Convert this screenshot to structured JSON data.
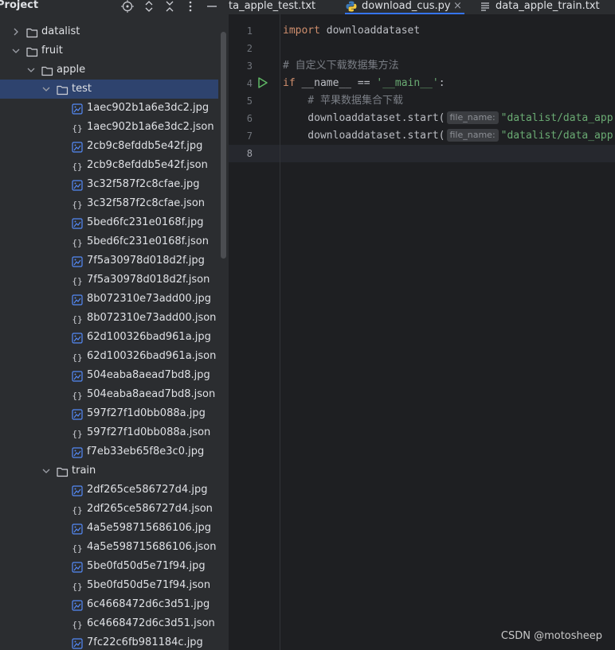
{
  "project": {
    "title": "Project",
    "header_icons": [
      "crosshair-icon",
      "expand-icon",
      "collapse-icon",
      "more-icon",
      "minimize-icon"
    ]
  },
  "tree": [
    {
      "label": "datalist",
      "type": "folder",
      "depth": 1,
      "expanded": false
    },
    {
      "label": "fruit",
      "type": "folder",
      "depth": 1,
      "expanded": true
    },
    {
      "label": "apple",
      "type": "folder",
      "depth": 2,
      "expanded": true
    },
    {
      "label": "test",
      "type": "folder",
      "depth": 3,
      "expanded": true,
      "selected": true
    },
    {
      "label": "1aec902b1a6e3dc2.jpg",
      "type": "image",
      "depth": 4
    },
    {
      "label": "1aec902b1a6e3dc2.json",
      "type": "json",
      "depth": 4
    },
    {
      "label": "2cb9c8efddb5e42f.jpg",
      "type": "image",
      "depth": 4
    },
    {
      "label": "2cb9c8efddb5e42f.json",
      "type": "json",
      "depth": 4
    },
    {
      "label": "3c32f587f2c8cfae.jpg",
      "type": "image",
      "depth": 4
    },
    {
      "label": "3c32f587f2c8cfae.json",
      "type": "json",
      "depth": 4
    },
    {
      "label": "5bed6fc231e0168f.jpg",
      "type": "image",
      "depth": 4
    },
    {
      "label": "5bed6fc231e0168f.json",
      "type": "json",
      "depth": 4
    },
    {
      "label": "7f5a30978d018d2f.jpg",
      "type": "image",
      "depth": 4
    },
    {
      "label": "7f5a30978d018d2f.json",
      "type": "json",
      "depth": 4
    },
    {
      "label": "8b072310e73add00.jpg",
      "type": "image",
      "depth": 4
    },
    {
      "label": "8b072310e73add00.json",
      "type": "json",
      "depth": 4
    },
    {
      "label": "62d100326bad961a.jpg",
      "type": "image",
      "depth": 4
    },
    {
      "label": "62d100326bad961a.json",
      "type": "json",
      "depth": 4
    },
    {
      "label": "504eaba8aead7bd8.jpg",
      "type": "image",
      "depth": 4
    },
    {
      "label": "504eaba8aead7bd8.json",
      "type": "json",
      "depth": 4
    },
    {
      "label": "597f27f1d0bb088a.jpg",
      "type": "image",
      "depth": 4
    },
    {
      "label": "597f27f1d0bb088a.json",
      "type": "json",
      "depth": 4
    },
    {
      "label": "f7eb33eb65f8e3c0.jpg",
      "type": "image",
      "depth": 4
    },
    {
      "label": "train",
      "type": "folder",
      "depth": 3,
      "expanded": true
    },
    {
      "label": "2df265ce586727d4.jpg",
      "type": "image",
      "depth": 4
    },
    {
      "label": "2df265ce586727d4.json",
      "type": "json",
      "depth": 4
    },
    {
      "label": "4a5e598715686106.jpg",
      "type": "image",
      "depth": 4
    },
    {
      "label": "4a5e598715686106.json",
      "type": "json",
      "depth": 4
    },
    {
      "label": "5be0fd50d5e71f94.jpg",
      "type": "image",
      "depth": 4
    },
    {
      "label": "5be0fd50d5e71f94.json",
      "type": "json",
      "depth": 4
    },
    {
      "label": "6c4668472d6c3d51.jpg",
      "type": "image",
      "depth": 4
    },
    {
      "label": "6c4668472d6c3d51.json",
      "type": "json",
      "depth": 4
    },
    {
      "label": "7fc22c6fb981184c.jpg",
      "type": "image",
      "depth": 4
    }
  ],
  "tabs": [
    {
      "label": "ta_apple_test.txt",
      "icon": "text-file-icon",
      "active": false
    },
    {
      "label": "download_cus.py",
      "icon": "python-icon",
      "active": true,
      "close": "×"
    },
    {
      "label": "data_apple_train.txt",
      "icon": "text-file-icon",
      "active": false
    }
  ],
  "editor": {
    "line_numbers": [
      "1",
      "2",
      "3",
      "4",
      "5",
      "6",
      "7",
      "8"
    ],
    "current_line": "8",
    "code": {
      "l1_kw": "import",
      "l1_rest": " downloaddataset",
      "l3": "# 自定义下载数据集方法",
      "l4_kw": "if",
      "l4_mid": " __name__ == ",
      "l4_str": "'__main__'",
      "l4_end": ":",
      "l5": "    # 苹果数据集合下载",
      "l6_call": "    downloaddataset.start(",
      "l6_hint": "file_name:",
      "l6_str": "\"datalist/data_app",
      "l7_call": "    downloaddataset.start(",
      "l7_hint": "file_name:",
      "l7_str": "\"datalist/data_app"
    }
  },
  "watermark": "CSDN @motosheep",
  "colors": {
    "keyword": "#cf8e6d",
    "string": "#6aab73",
    "comment": "#7a7e85",
    "selection": "#2e436e",
    "accent": "#3574f0"
  }
}
